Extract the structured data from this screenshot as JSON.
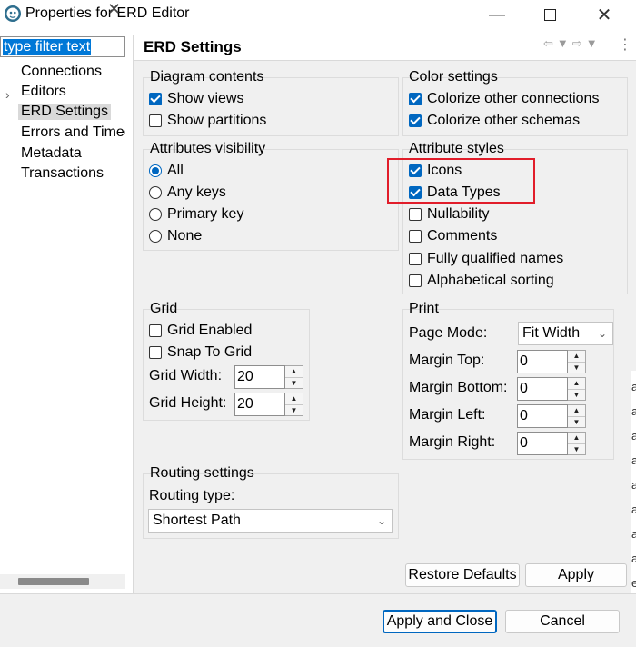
{
  "window": {
    "title": "Properties for ERD Editor",
    "minimize_icon": "minimize-icon",
    "maximize_icon": "maximize-icon",
    "close_icon": "close-icon"
  },
  "sidebar": {
    "filter_placeholder": "type filter text",
    "items": [
      {
        "label": "Connections"
      },
      {
        "label": "Editors"
      },
      {
        "label": "ERD Settings"
      },
      {
        "label": "Errors and Timeo"
      },
      {
        "label": "Metadata"
      },
      {
        "label": "Transactions"
      }
    ]
  },
  "page": {
    "title": "ERD Settings"
  },
  "diagram_contents": {
    "label": "Diagram contents",
    "show_views": {
      "label": "Show views",
      "checked": true
    },
    "show_partitions": {
      "label": "Show partitions",
      "checked": false
    }
  },
  "color_settings": {
    "label": "Color settings",
    "colorize_connections": {
      "label": "Colorize other connections",
      "checked": true
    },
    "colorize_schemas": {
      "label": "Colorize other schemas",
      "checked": true
    }
  },
  "attributes_visibility": {
    "label": "Attributes visibility",
    "options": [
      {
        "label": "All",
        "selected": true
      },
      {
        "label": "Any keys",
        "selected": false
      },
      {
        "label": "Primary key",
        "selected": false
      },
      {
        "label": "None",
        "selected": false
      }
    ]
  },
  "attribute_styles": {
    "label": "Attribute styles",
    "options": [
      {
        "label": "Icons",
        "checked": true
      },
      {
        "label": "Data Types",
        "checked": true
      },
      {
        "label": "Nullability",
        "checked": false
      },
      {
        "label": "Comments",
        "checked": false
      },
      {
        "label": "Fully qualified names",
        "checked": false
      },
      {
        "label": "Alphabetical sorting",
        "checked": false
      }
    ]
  },
  "grid": {
    "label": "Grid",
    "grid_enabled": {
      "label": "Grid Enabled",
      "checked": false
    },
    "snap_to_grid": {
      "label": "Snap To Grid",
      "checked": false
    },
    "grid_width": {
      "label": "Grid Width:",
      "value": "20"
    },
    "grid_height": {
      "label": "Grid Height:",
      "value": "20"
    }
  },
  "print": {
    "label": "Print",
    "page_mode": {
      "label": "Page Mode:",
      "value": "Fit Width"
    },
    "margin_top": {
      "label": "Margin Top:",
      "value": "0"
    },
    "margin_bottom": {
      "label": "Margin Bottom:",
      "value": "0"
    },
    "margin_left": {
      "label": "Margin Left:",
      "value": "0"
    },
    "margin_right": {
      "label": "Margin Right:",
      "value": "0"
    }
  },
  "routing": {
    "label": "Routing settings",
    "type_label": "Routing type:",
    "type_value": "Shortest Path"
  },
  "buttons": {
    "restore_defaults": "Restore Defaults",
    "apply": "Apply",
    "apply_and_close": "Apply and Close",
    "cancel": "Cancel"
  },
  "background_strip": [
    "a",
    "a",
    "a",
    "a",
    "a",
    "a",
    "a",
    "a",
    "e"
  ],
  "colors": {
    "accent": "#0067c0",
    "selection": "#0078d7",
    "highlight_box": "#e11d2a"
  }
}
